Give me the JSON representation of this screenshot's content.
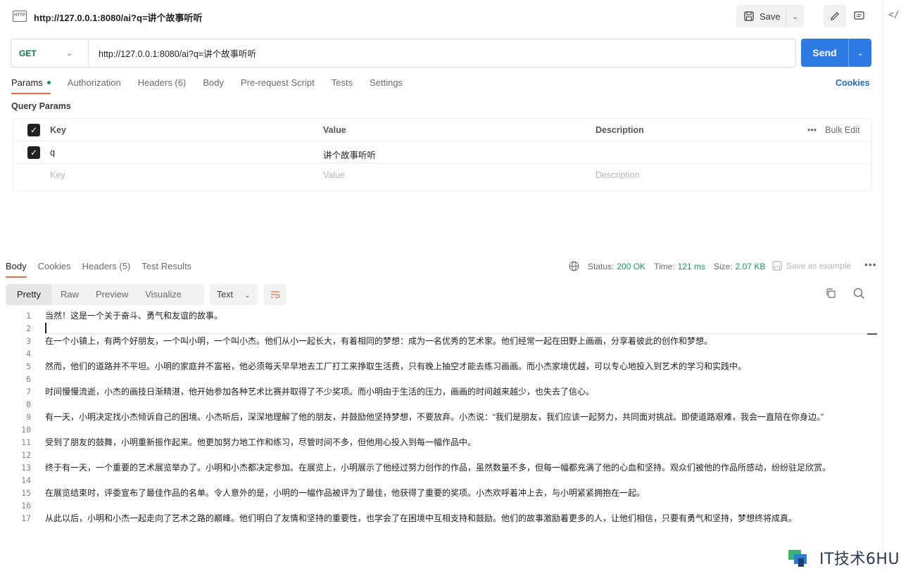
{
  "request": {
    "icon_text": "HTTP",
    "title": "http://127.0.0.1:8080/ai?q=讲个故事听听",
    "save_label": "Save",
    "method": "GET",
    "url": "http://127.0.0.1:8080/ai?q=讲个故事听听",
    "send_label": "Send"
  },
  "request_tabs": [
    {
      "label": "Params",
      "active": true
    },
    {
      "label": "Authorization"
    },
    {
      "label": "Headers (6)"
    },
    {
      "label": "Body"
    },
    {
      "label": "Pre-request Script"
    },
    {
      "label": "Tests"
    },
    {
      "label": "Settings"
    }
  ],
  "cookies_link": "Cookies",
  "params": {
    "section_label": "Query Params",
    "headers": {
      "key": "Key",
      "value": "Value",
      "description": "Description"
    },
    "bulk_edit": "Bulk Edit",
    "rows": [
      {
        "key": "q",
        "value": "讲个故事听听",
        "description": ""
      }
    ],
    "placeholder": {
      "key": "Key",
      "value": "Value",
      "description": "Description"
    }
  },
  "response": {
    "tabs": [
      {
        "label": "Body",
        "active": true
      },
      {
        "label": "Cookies"
      },
      {
        "label": "Headers (5)"
      },
      {
        "label": "Test Results"
      }
    ],
    "status_label": "Status:",
    "status_value": "200 OK",
    "time_label": "Time:",
    "time_value": "121 ms",
    "size_label": "Size:",
    "size_value": "2.07 KB",
    "save_example": "Save as example",
    "views": [
      "Pretty",
      "Raw",
      "Preview",
      "Visualize"
    ],
    "format": "Text",
    "lines": [
      "当然！这是一个关于奋斗、勇气和友谊的故事。",
      "",
      "在一个小镇上，有两个好朋友，一个叫小明，一个叫小杰。他们从小一起长大，有着相同的梦想：成为一名优秀的艺术家。他们经常一起在田野上画画，分享着彼此的创作和梦想。",
      "",
      "然而，他们的道路并不平坦。小明的家庭并不富裕，他必须每天早早地去工厂打工来挣取生活费，只有晚上抽空才能去练习画画。而小杰家境优越，可以专心地投入到艺术的学习和实践中。",
      "",
      "时间慢慢流逝，小杰的画技日渐精湛，他开始参加各种艺术比赛并取得了不少奖项。而小明由于生活的压力，画画的时间越来越少，也失去了信心。",
      "",
      "有一天，小明决定找小杰倾诉自己的困境。小杰听后，深深地理解了他的朋友，并鼓励他坚持梦想，不要放弃。小杰说：“我们是朋友，我们应该一起努力，共同面对挑战。即使道路艰难，我会一直陪在你身边。”",
      "",
      "受到了朋友的鼓舞，小明重新振作起来。他更加努力地工作和练习，尽管时间不多，但他用心投入到每一幅作品中。",
      "",
      "终于有一天，一个重要的艺术展览举办了。小明和小杰都决定参加。在展览上，小明展示了他经过努力创作的作品，虽然数量不多，但每一幅都充满了他的心血和坚持。观众们被他的作品所感动，纷纷驻足欣赏。",
      "",
      "在展览结束时，评委宣布了最佳作品的名单。令人意外的是，小明的一幅作品被评为了最佳，他获得了重要的奖项。小杰欢呼着冲上去，与小明紧紧拥抱在一起。",
      "",
      "从此以后，小明和小杰一起走向了艺术之路的巅峰。他们明白了友情和坚持的重要性，也学会了在困境中互相支持和鼓励。他们的故事激励着更多的人，让他们相信，只要有勇气和坚持，梦想终将成真。"
    ]
  },
  "watermark": "IT技术6HU",
  "colors": {
    "accent": "#f26b3a",
    "send": "#2c7be5",
    "method_get": "#0b7a3b",
    "status_ok": "#0f9d58",
    "link": "#1f6bc5"
  }
}
